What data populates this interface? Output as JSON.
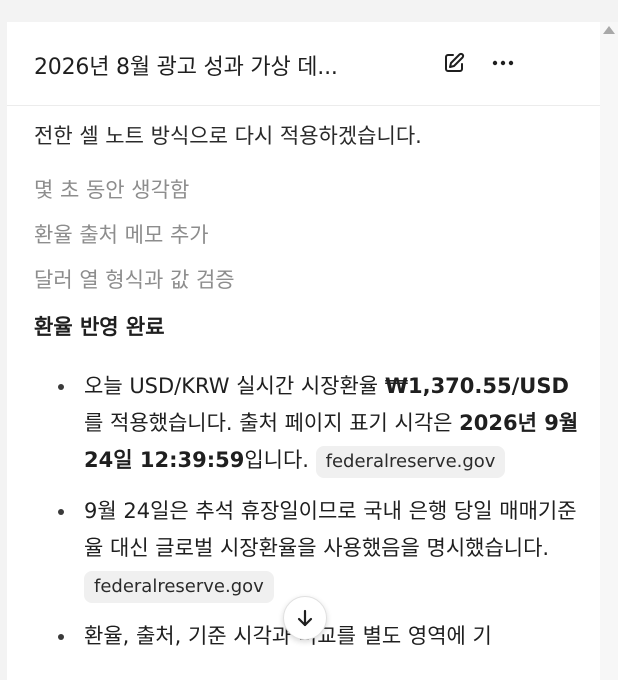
{
  "header": {
    "title": "2026년 8월 광고 성과 가상 데...",
    "edit_icon": "edit-icon",
    "more_icon": "more-horizontal-icon"
  },
  "content": {
    "clipped_line": "전한 셀 노트 방식으로 다시 적용하겠습니다.",
    "steps": [
      "몇 초 동안 생각함",
      "환율 출처 메모 추가",
      "달러 열 형식과 값 검증"
    ],
    "section_title": "환율 반영 완료",
    "bullets": [
      {
        "t1": "오늘 USD/KRW 실시간 시장환율 ",
        "b1": "₩1,370.55/USD",
        "t2": "를 적용했습니다. 출처 페이지 표기 시각은 ",
        "b2": "2026년 9월 24일 12:39:59",
        "t3": "입니다. ",
        "chip": "federalreserve.gov"
      },
      {
        "t1": "9월 24일은 추석 휴장일이므로 국내 은행 당일 매매기준율 대신 글로벌 시장환율을 사용했음을 명시했습니다. ",
        "chip": "federalreserve.gov"
      },
      {
        "t1": "환율, 출처, 기준 시각과 비교를 별도 영역에 기"
      }
    ]
  },
  "scroll_down_icon": "arrow-down-icon",
  "colors": {
    "text": "#1f1f1f",
    "muted": "#8d8d8d",
    "chip_bg": "#f0f0f0",
    "background": "#ffffff"
  }
}
